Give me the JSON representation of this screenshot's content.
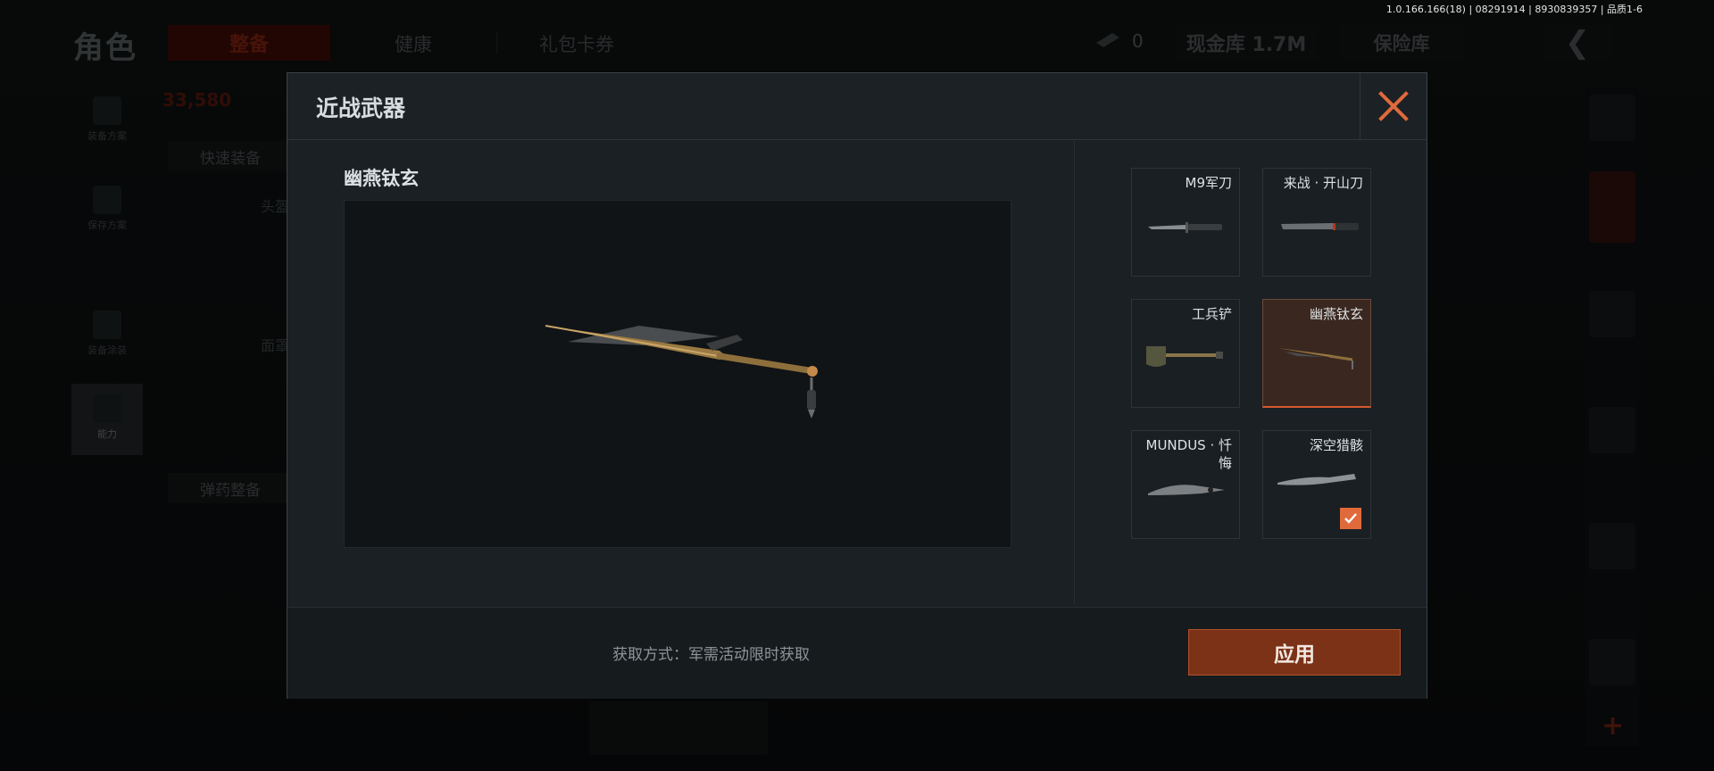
{
  "version_text": "1.0.166.166(18) | 08291914 | 8930839357 | 品质1-6",
  "background": {
    "page_title": "角色",
    "tabs": [
      {
        "label": "整备",
        "active": true
      },
      {
        "label": "健康",
        "active": false
      },
      {
        "label": "礼包卡券",
        "active": false
      }
    ],
    "currency_value": "0",
    "stash_label": "现金库 1.7M",
    "insurance_label": "保险库",
    "back_icon": "chevron-left-icon",
    "sidebar": [
      {
        "label": "装备方案",
        "icon": "vest-icon"
      },
      {
        "label": "保存方案",
        "icon": "download-icon"
      },
      {
        "label": "装备涂装",
        "icon": "helmet-icon"
      },
      {
        "label": "能力",
        "icon": "ability-icon",
        "active": true
      }
    ],
    "left_panel": {
      "value_text": "33,580",
      "quick_equip_label": "快速装备",
      "ammo_label": "弹药整备",
      "slot_labels": [
        "头盔",
        "面罩"
      ]
    }
  },
  "modal": {
    "title": "近战武器",
    "close_icon": "close-icon",
    "preview_title": "幽燕钛玄",
    "weapons": [
      {
        "name": "M9军刀",
        "icon": "knife-icon",
        "selected": false,
        "equipped": false
      },
      {
        "name": "来战 · 开山刀",
        "icon": "machete-icon",
        "selected": false,
        "equipped": false
      },
      {
        "name": "工兵铲",
        "icon": "shovel-icon",
        "selected": false,
        "equipped": false
      },
      {
        "name": "幽燕钛玄",
        "icon": "sword-icon",
        "selected": true,
        "equipped": false
      },
      {
        "name": "MUNDUS · 忏悔",
        "icon": "karambit-icon",
        "selected": false,
        "equipped": false
      },
      {
        "name": "深空猎骸",
        "icon": "blade-icon",
        "selected": false,
        "equipped": true
      }
    ],
    "source_text": "获取方式：军需活动限时获取",
    "apply_label": "应用"
  },
  "colors": {
    "accent": "#e06a3b",
    "apply_bg": "#7b3217",
    "modal_bg": "#1b2024"
  }
}
